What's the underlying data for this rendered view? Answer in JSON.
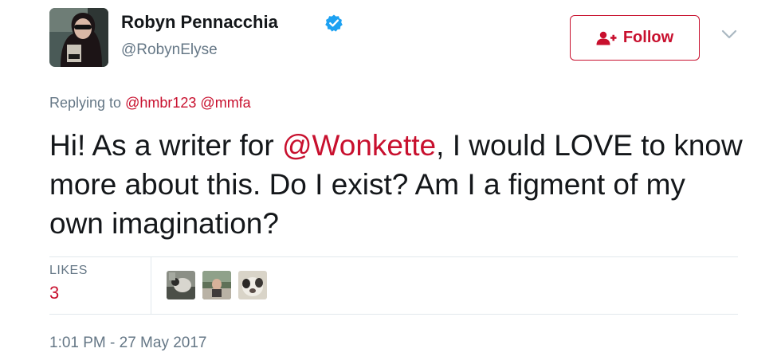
{
  "author": {
    "display_name": "Robyn Pennacchia",
    "handle": "@RobynElyse",
    "verified": true,
    "avatar_icon": "user-avatar-photo"
  },
  "actions": {
    "follow_label": "Follow",
    "follow_icon": "add-user-icon",
    "menu_icon": "chevron-down-icon"
  },
  "reply": {
    "prefix": "Replying to",
    "mentions": [
      "@hmbr123",
      "@mmfa"
    ]
  },
  "tweet": {
    "text_before": "Hi! As a writer for ",
    "mention": "@Wonkette",
    "text_after": ", I would LOVE to know more about this. Do I exist? Am I a figment of my own imagination?"
  },
  "stats": {
    "likes_label": "LIKES",
    "likes_count": "3",
    "liker_avatars": [
      "liker-avatar-1",
      "liker-avatar-2",
      "liker-avatar-3"
    ]
  },
  "timestamp": "1:01 PM - 27 May 2017",
  "colors": {
    "accent": "#c8102e",
    "verified": "#1da1f2",
    "muted": "#657786",
    "text": "#14171a",
    "divider": "#e1e8ed"
  }
}
